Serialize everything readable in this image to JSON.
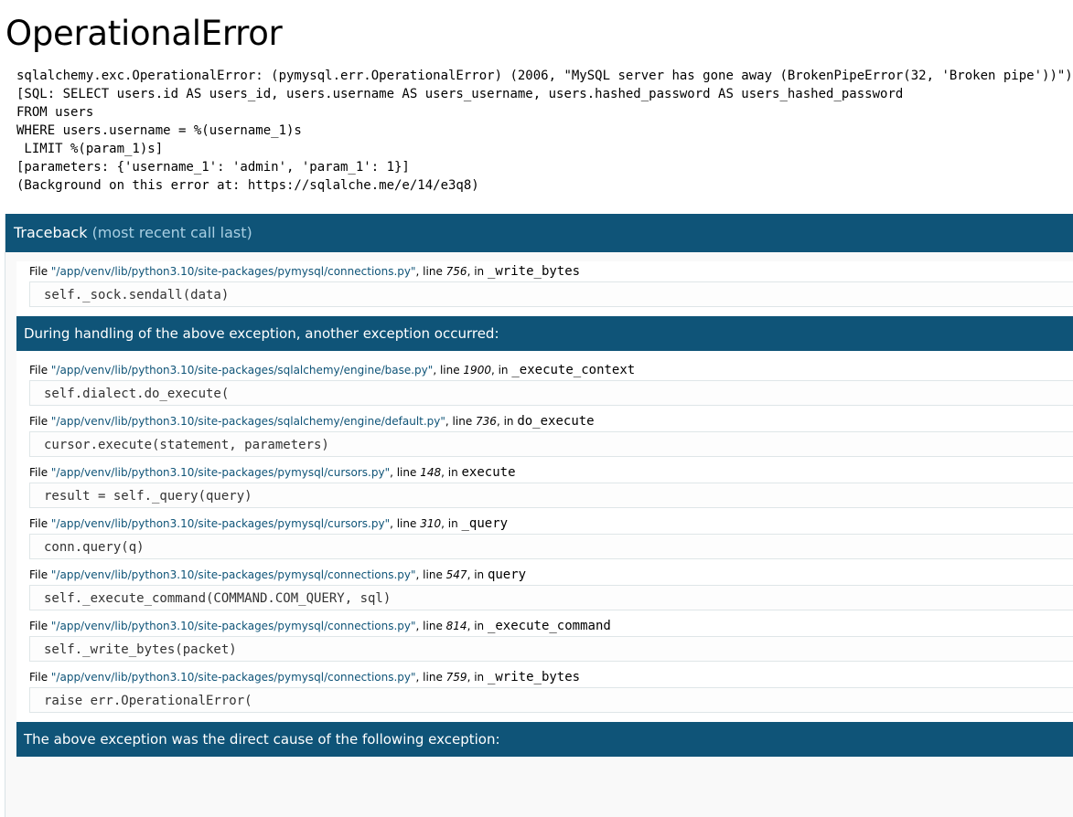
{
  "title": "OperationalError",
  "error_message": "sqlalchemy.exc.OperationalError: (pymysql.err.OperationalError) (2006, \"MySQL server has gone away (BrokenPipeError(32, 'Broken pipe'))\")\n[SQL: SELECT users.id AS users_id, users.username AS users_username, users.hashed_password AS users_hashed_password\nFROM users\nWHERE users.username = %(username_1)s\n LIMIT %(param_1)s]\n[parameters: {'username_1': 'admin', 'param_1': 1}]\n(Background on this error at: https://sqlalche.me/e/14/e3q8)",
  "traceback": {
    "header": "Traceback",
    "header_sub": "(most recent call last)",
    "frames_a": [
      {
        "file": "\"/app/venv/lib/python3.10/site-packages/pymysql/connections.py\"",
        "line": "756",
        "func": "_write_bytes",
        "code": "self._sock.sendall(data)"
      }
    ],
    "separator_1": "During handling of the above exception, another exception occurred:",
    "frames_b": [
      {
        "file": "\"/app/venv/lib/python3.10/site-packages/sqlalchemy/engine/base.py\"",
        "line": "1900",
        "func": "_execute_context",
        "code": "self.dialect.do_execute("
      },
      {
        "file": "\"/app/venv/lib/python3.10/site-packages/sqlalchemy/engine/default.py\"",
        "line": "736",
        "func": "do_execute",
        "code": "cursor.execute(statement, parameters)"
      },
      {
        "file": "\"/app/venv/lib/python3.10/site-packages/pymysql/cursors.py\"",
        "line": "148",
        "func": "execute",
        "code": "result = self._query(query)"
      },
      {
        "file": "\"/app/venv/lib/python3.10/site-packages/pymysql/cursors.py\"",
        "line": "310",
        "func": "_query",
        "code": "conn.query(q)"
      },
      {
        "file": "\"/app/venv/lib/python3.10/site-packages/pymysql/connections.py\"",
        "line": "547",
        "func": "query",
        "code": "self._execute_command(COMMAND.COM_QUERY, sql)"
      },
      {
        "file": "\"/app/venv/lib/python3.10/site-packages/pymysql/connections.py\"",
        "line": "814",
        "func": "_execute_command",
        "code": "self._write_bytes(packet)"
      },
      {
        "file": "\"/app/venv/lib/python3.10/site-packages/pymysql/connections.py\"",
        "line": "759",
        "func": "_write_bytes",
        "code": "raise err.OperationalError("
      }
    ],
    "separator_2": "The above exception was the direct cause of the following exception:",
    "labels": {
      "file": "File ",
      "line": ", line ",
      "in": ", in "
    }
  }
}
